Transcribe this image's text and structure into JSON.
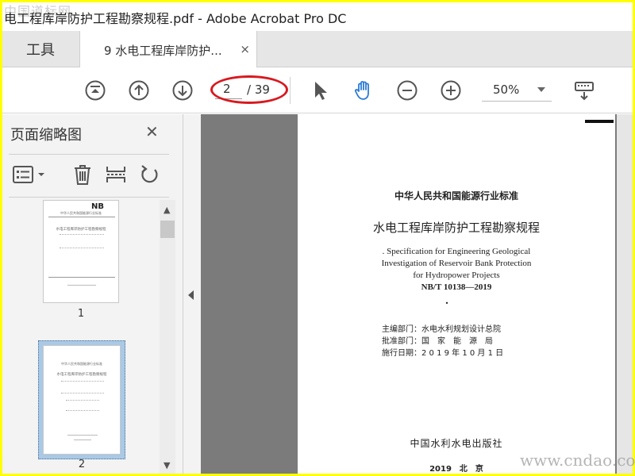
{
  "watermark": {
    "top_left": "中国道标网",
    "bottom_right": "www.cndao.com"
  },
  "window": {
    "title": "电工程库岸防护工程勘察规程.pdf - Adobe Acrobat Pro DC"
  },
  "tabs": {
    "tools_label": "工具",
    "doc_label": "9 水电工程库岸防护...",
    "close_glyph": "×"
  },
  "toolbar": {
    "page_current": "2",
    "page_total": "/ 39",
    "zoom": "50%"
  },
  "sidebar": {
    "title": "页面缩略图",
    "close_glyph": "✕",
    "thumbnails": [
      {
        "number": "1",
        "badge": "NB",
        "line1": "中华人民共和国能源行业标准",
        "line2": "水电工程库岸防护工程勘察规程"
      },
      {
        "number": "2",
        "line1": "中华人民共和国能源行业标准",
        "line2": "水电工程库岸防护工程勘察规程"
      }
    ]
  },
  "document": {
    "header": "中华人民共和国能源行业标准",
    "title_cn": "水电工程库岸防护工程勘察规程",
    "title_en_1": ". Specification for Engineering Geological",
    "title_en_2": "Investigation of Reservoir Bank Protection",
    "title_en_3": "for Hydropower Projects",
    "code": "NB/T 10138—2019",
    "dot": "•",
    "dept_label": "主编部门：水电水利规划设计总院",
    "approve_label": "批准部门：国　家　能　源　局",
    "date_label": "施行日期：2 0 1 9 年 1 0 月 1 日",
    "publisher": "中国水利水电出版社",
    "year_place": "2019　北　京"
  },
  "colors": {
    "highlight_ring": "#d8191f",
    "hand_tool": "#2a7bd6",
    "doc_bg": "#7b7b7b"
  }
}
